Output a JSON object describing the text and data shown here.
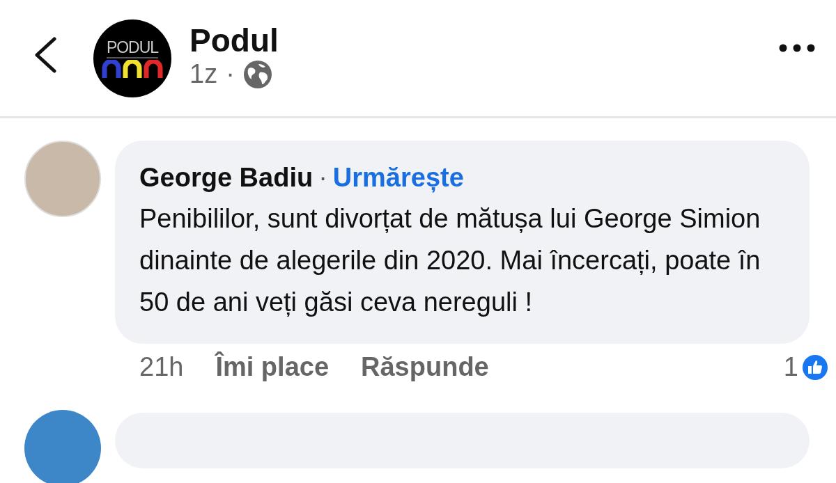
{
  "header": {
    "page_name": "Podul",
    "logo_text": "PODUL",
    "time": "1z",
    "separator": "·"
  },
  "comments": [
    {
      "author": "George Badiu",
      "separator": "·",
      "follow": "Urmărește",
      "text": "Penibililor, sunt divorțat de mătușa lui George Simion dinainte de alegerile din 2020. Mai încercați, poate în 50 de ani veți găsi ceva nereguli !",
      "time": "21h",
      "like": "Îmi place",
      "reply": "Răspunde",
      "reaction_count": "1"
    }
  ]
}
